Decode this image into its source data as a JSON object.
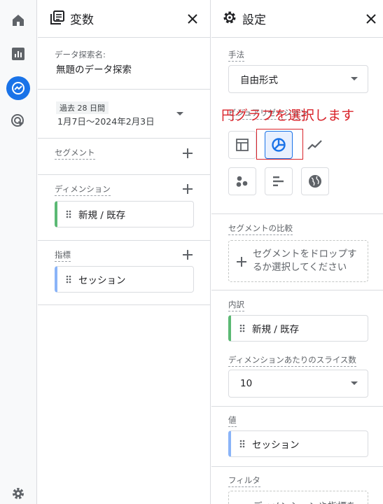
{
  "variables_panel": {
    "title": "変数",
    "exploration_name_label": "データ探索名:",
    "exploration_name": "無題のデータ探索",
    "date_range_badge": "過去 28 日間",
    "date_range": "1月7日～2024年2月3日",
    "segments_label": "セグメント",
    "dimensions_label": "ディメンション",
    "dimensions": [
      "新規 / 既存"
    ],
    "metrics_label": "指標",
    "metrics": [
      "セッション"
    ]
  },
  "settings_panel": {
    "title": "設定",
    "technique_label": "手法",
    "technique_value": "自由形式",
    "visualization_label": "ビジュアリゼーション",
    "annotation": "円グラフを選択します",
    "segment_compare_label": "セグメントの比較",
    "segment_drop_text": "セグメントをドロップするか選択してください",
    "breakdown_label": "内訳",
    "breakdown_value": "新規 / 既存",
    "slices_label": "ディメンションあたりのスライス数",
    "slices_value": "10",
    "values_label": "値",
    "values_value": "セッション",
    "filter_label": "フィルタ",
    "filter_drop_text": "ディメンションや指標を"
  },
  "colors": {
    "accent": "#1a73e8",
    "annotation": "#d9232a",
    "dimension_chip": "#5bb974",
    "metric_chip": "#8ab4f8"
  }
}
